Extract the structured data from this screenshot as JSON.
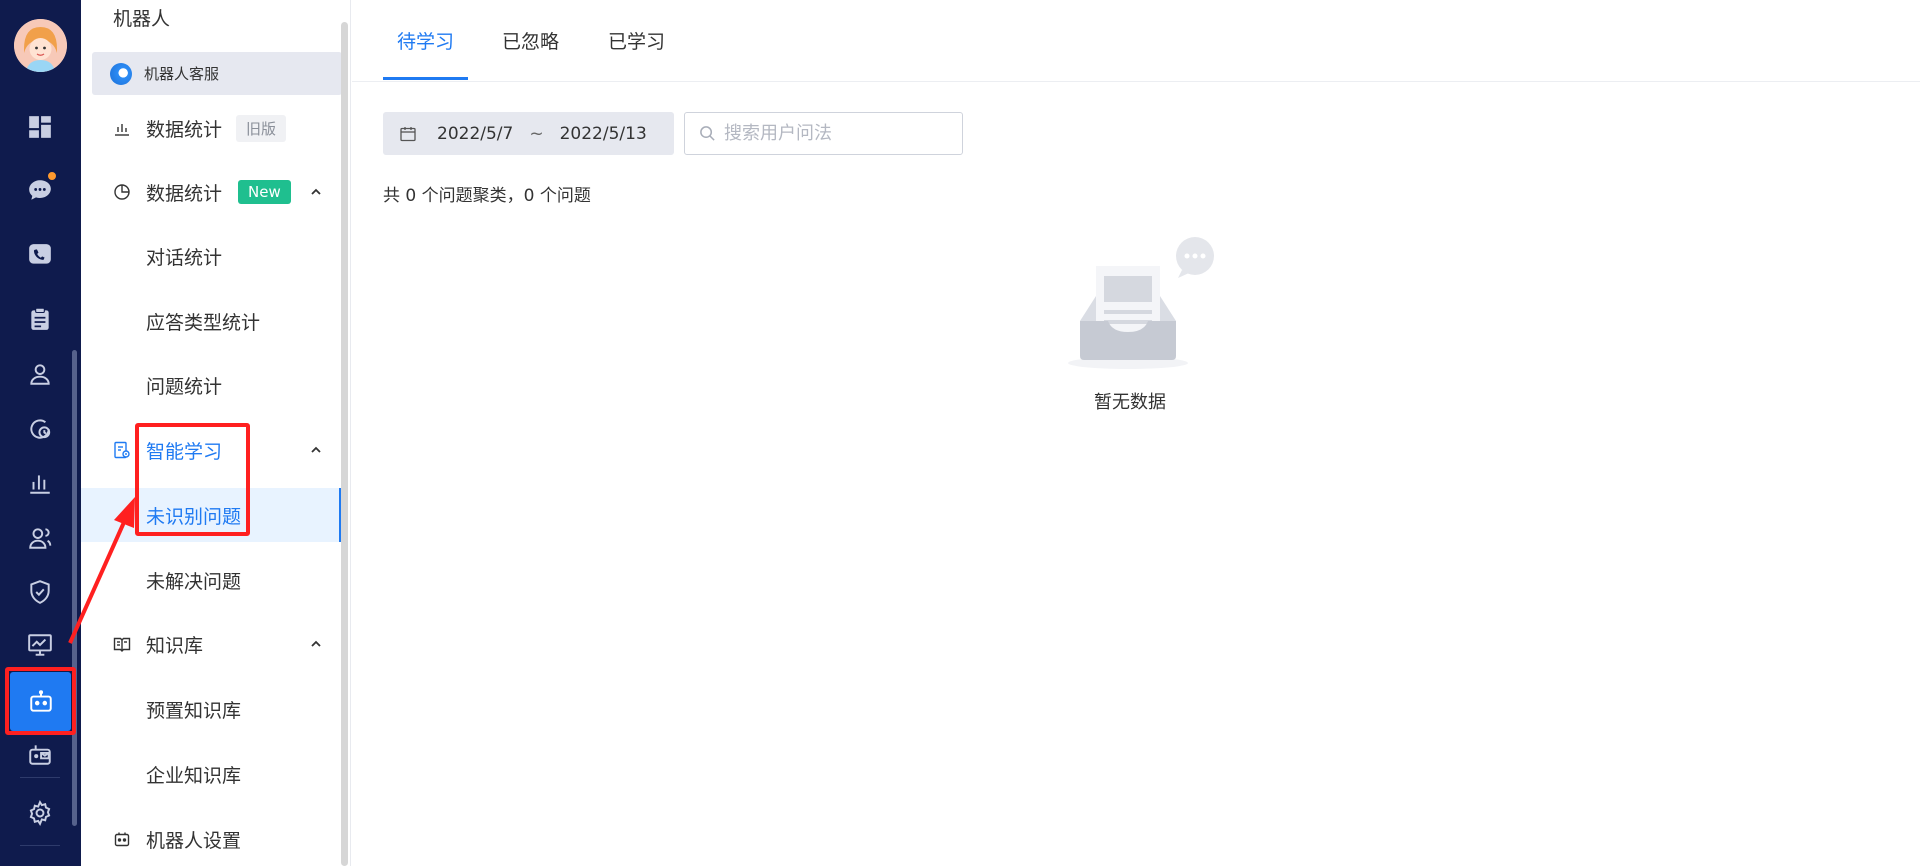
{
  "menu": {
    "header": "机器人",
    "robot_chip": "机器人客服",
    "items": [
      {
        "label": "数据统计",
        "tag": "旧版"
      },
      {
        "label": "数据统计",
        "tag": "New"
      },
      {
        "label": "对话统计"
      },
      {
        "label": "应答类型统计"
      },
      {
        "label": "问题统计"
      },
      {
        "label": "智能学习"
      },
      {
        "label": "未识别问题"
      },
      {
        "label": "未解决问题"
      },
      {
        "label": "知识库"
      },
      {
        "label": "预置知识库"
      },
      {
        "label": "企业知识库"
      },
      {
        "label": "机器人设置"
      }
    ]
  },
  "tabs": [
    {
      "label": "待学习"
    },
    {
      "label": "已忽略"
    },
    {
      "label": "已学习"
    }
  ],
  "filters": {
    "date_start": "2022/5/7",
    "date_sep": "~",
    "date_end": "2022/5/13",
    "search_placeholder": "搜索用户问法"
  },
  "summary": "共 0 个问题聚类，0 个问题",
  "empty_text": "暂无数据",
  "colors": {
    "rail_bg": "#0f1b4d",
    "accent": "#1f7af2",
    "new_tag": "#1fbf8f",
    "annotation": "#ff2020"
  }
}
